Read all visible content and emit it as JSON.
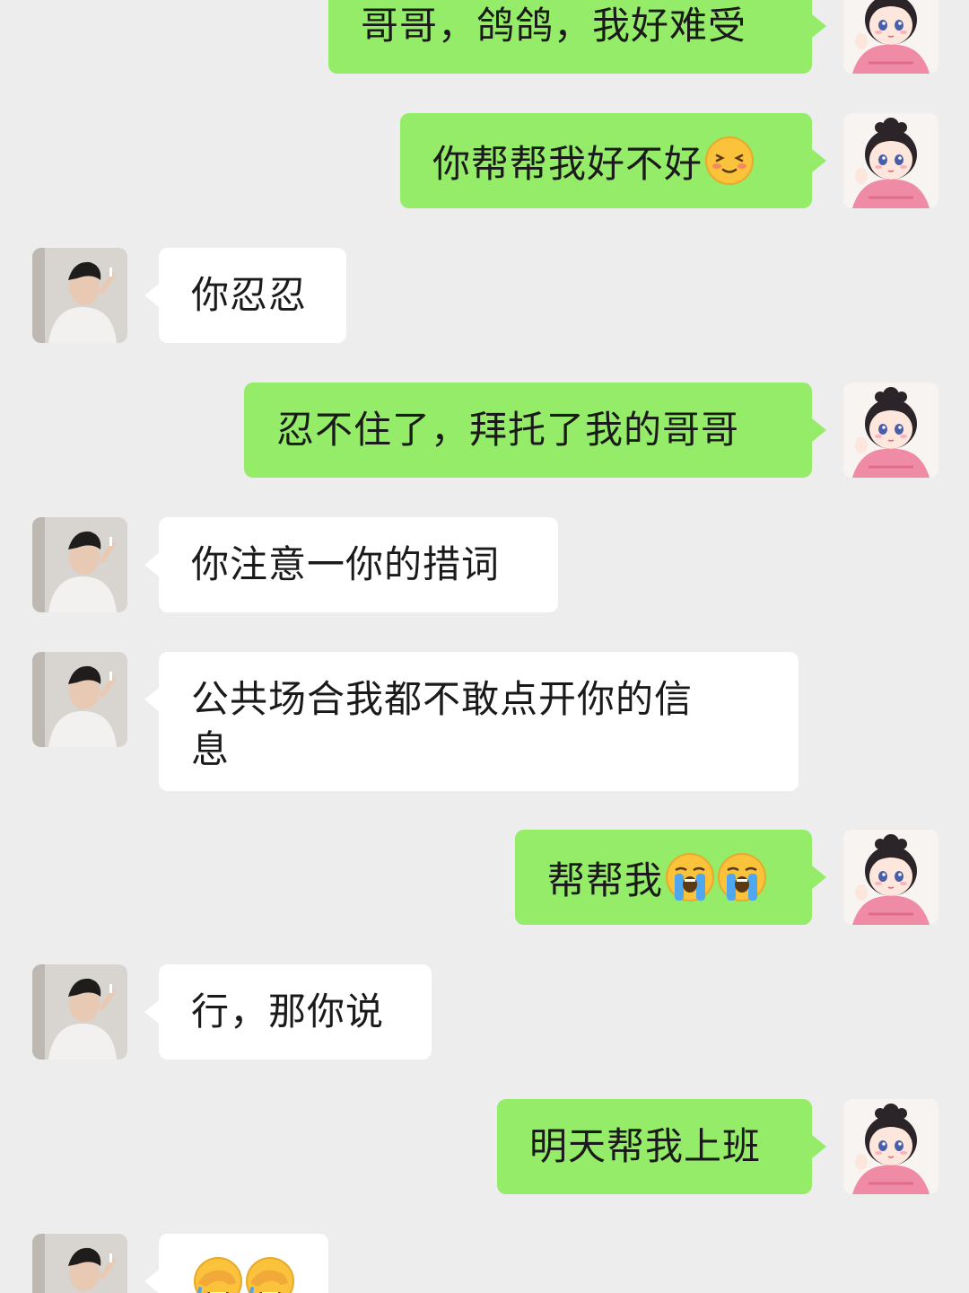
{
  "messages": [
    {
      "sender": "self",
      "text": "哥哥，鸽鸽，我好难受"
    },
    {
      "sender": "self",
      "text": "你帮帮我好不好",
      "emoji": [
        "blush-smile-emoji"
      ]
    },
    {
      "sender": "other",
      "text": "你忍忍"
    },
    {
      "sender": "self",
      "text": "忍不住了，拜托了我的哥哥"
    },
    {
      "sender": "other",
      "text": "你注意一你的措词"
    },
    {
      "sender": "other",
      "text": "公共场合我都不敢点开你的信",
      "text2": "息"
    },
    {
      "sender": "self",
      "text": "帮帮我",
      "emoji": [
        "loudly-crying-emoji",
        "loudly-crying-emoji"
      ]
    },
    {
      "sender": "other",
      "text": "行，那你说"
    },
    {
      "sender": "self",
      "text": "明天帮我上班"
    },
    {
      "sender": "other",
      "text": "",
      "emoji": [
        "facepalm-laugh-emoji",
        "facepalm-laugh-emoji"
      ]
    }
  ],
  "colors": {
    "background": "#ededed",
    "self_bubble": "#95ec69",
    "other_bubble": "#ffffff"
  }
}
